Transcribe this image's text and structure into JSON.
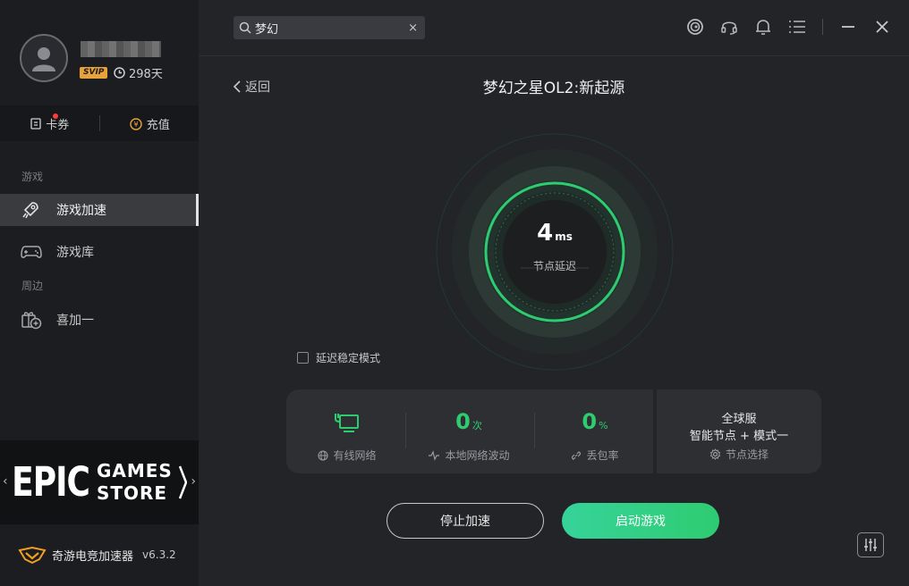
{
  "user": {
    "badge": "SVIP",
    "days": "298天"
  },
  "sidebar": {
    "coupon_label": "卡券",
    "recharge_label": "充值",
    "section_games": "游戏",
    "items": [
      {
        "label": "游戏加速",
        "icon": "rocket-icon"
      },
      {
        "label": "游戏库",
        "icon": "gamepad-icon"
      }
    ],
    "section_around": "周边",
    "around_items": [
      {
        "label": "喜加一",
        "icon": "gift-plus-icon"
      }
    ]
  },
  "banner": {
    "big": "EPIC",
    "line1": "GAMES",
    "line2": "STORE",
    "prev": "‹",
    "next": "›"
  },
  "brand": {
    "name": "奇游电竞加速器",
    "version": "v6.3.2"
  },
  "search": {
    "value": "梦幻",
    "clear": "×"
  },
  "main": {
    "back_label": "返回",
    "game_title": "梦幻之星OL2:新起源",
    "latency_value": "4",
    "latency_unit": "ms",
    "latency_label": "节点延迟",
    "stable_mode_label": "延迟稳定模式",
    "stats": [
      {
        "value": "",
        "unit": "",
        "label": "有线网络",
        "icon": "ethernet-icon"
      },
      {
        "value": "0",
        "unit": "次",
        "label": "本地网络波动",
        "icon": "pulse-icon"
      },
      {
        "value": "0",
        "unit": "%",
        "label": "丢包率",
        "icon": "link-icon"
      }
    ],
    "node": {
      "region": "全球服",
      "mode": "智能节点 + 模式一",
      "select_label": "节点选择"
    },
    "stop_label": "停止加速",
    "start_label": "启动游戏"
  },
  "colors": {
    "accent": "#2ecc71",
    "svip": "#e8a23a"
  }
}
